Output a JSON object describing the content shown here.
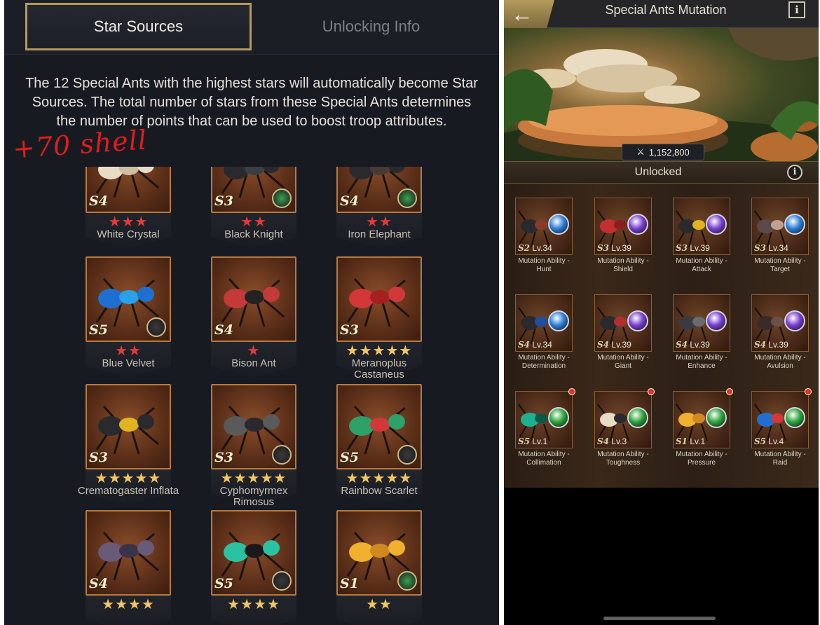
{
  "left": {
    "tabs": [
      {
        "label": "Star Sources",
        "active": true
      },
      {
        "label": "Unlocking Info",
        "active": false
      }
    ],
    "description": "The 12 Special Ants with the highest stars will automatically become Star Sources. The total number of stars from these Special Ants determines the number of points that can be used to boost troop attributes.",
    "annotation": "+70 shell",
    "ants": [
      {
        "name": "White Crystal",
        "grade": "S4",
        "stars": 3,
        "star_color": "red"
      },
      {
        "name": "Black Knight",
        "grade": "S3",
        "stars": 2,
        "star_color": "red"
      },
      {
        "name": "Iron Elephant",
        "grade": "S4",
        "stars": 2,
        "star_color": "red"
      },
      {
        "name": "Blue Velvet",
        "grade": "S5",
        "stars": 2,
        "star_color": "red"
      },
      {
        "name": "Bison Ant",
        "grade": "S4",
        "stars": 1,
        "star_color": "red"
      },
      {
        "name": "Meranoplus Castaneus",
        "grade": "S3",
        "stars": 5,
        "star_color": "gold"
      },
      {
        "name": "Crematogaster Inflata",
        "grade": "S3",
        "stars": 5,
        "star_color": "gold"
      },
      {
        "name": "Cyphomyrmex Rimosus",
        "grade": "S3",
        "stars": 5,
        "star_color": "gold"
      },
      {
        "name": "Rainbow Scarlet",
        "grade": "S5",
        "stars": 5,
        "star_color": "gold"
      },
      {
        "name": "",
        "grade": "S4",
        "stars": 4,
        "star_color": "gold"
      },
      {
        "name": "",
        "grade": "S5",
        "stars": 4,
        "star_color": "gold"
      },
      {
        "name": "",
        "grade": "S1",
        "stars": 2,
        "star_color": "gold"
      }
    ]
  },
  "right": {
    "title": "Special Ants Mutation",
    "back_icon": "arrow-left-icon",
    "info_label": "i",
    "power": "1,152,800",
    "status": "Unlocked",
    "mutations": [
      {
        "grade": "S2",
        "level": "Lv.34",
        "label": "Mutation Ability - Hunt",
        "orb": "#2f7fd6",
        "dot": false
      },
      {
        "grade": "S3",
        "level": "Lv.39",
        "label": "Mutation Ability - Shield",
        "orb": "#7a3fd0",
        "dot": false
      },
      {
        "grade": "S3",
        "level": "Lv.39",
        "label": "Mutation Ability - Attack",
        "orb": "#7a3fd0",
        "dot": false
      },
      {
        "grade": "S3",
        "level": "Lv.34",
        "label": "Mutation Ability - Target",
        "orb": "#2f7fd6",
        "dot": false
      },
      {
        "grade": "S4",
        "level": "Lv.34",
        "label": "Mutation Ability - Determination",
        "orb": "#2f7fd6",
        "dot": false
      },
      {
        "grade": "S4",
        "level": "Lv.39",
        "label": "Mutation Ability - Giant",
        "orb": "#7a3fd0",
        "dot": false
      },
      {
        "grade": "S4",
        "level": "Lv.39",
        "label": "Mutation Ability - Enhance",
        "orb": "#7a3fd0",
        "dot": false
      },
      {
        "grade": "S4",
        "level": "Lv.39",
        "label": "Mutation Ability - Avulsion",
        "orb": "#7a3fd0",
        "dot": false
      },
      {
        "grade": "S5",
        "level": "Lv.1",
        "label": "Mutation Ability - Collimation",
        "orb": "#2ea53a",
        "dot": true
      },
      {
        "grade": "S4",
        "level": "Lv.3",
        "label": "Mutation Ability - Toughness",
        "orb": "#2ea53a",
        "dot": true
      },
      {
        "grade": "S1",
        "level": "Lv.1",
        "label": "Mutation Ability - Pressure",
        "orb": "#2ea53a",
        "dot": true
      },
      {
        "grade": "S5",
        "level": "Lv.4",
        "label": "Mutation Ability - Raid",
        "orb": "#2ea53a",
        "dot": true
      }
    ]
  }
}
